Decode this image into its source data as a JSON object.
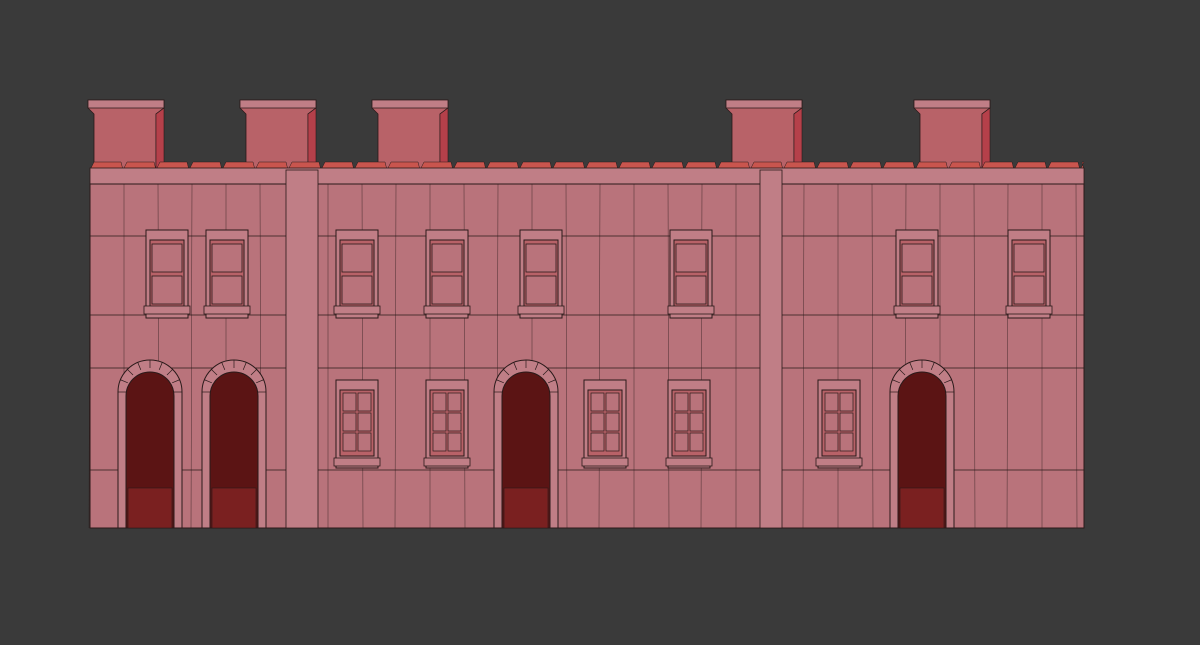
{
  "viewport": {
    "background_color": "#3a3a3a",
    "render_mode": "wireframe-on-shaded",
    "wire_color": "#2a1a1a"
  },
  "model": {
    "type": "terraced-house-facade",
    "wall_color": "#b9737b",
    "wall_light_color": "#c07e86",
    "roof_color": "#b5404a",
    "roof_light_color": "#c9554e",
    "chimney_color": "#b86268",
    "recess_color": "#5b1414",
    "chimney_count": 5,
    "storeys": 2,
    "upper_window_count": 8,
    "lower_window_count": 5,
    "arched_doorway_count": 4
  }
}
